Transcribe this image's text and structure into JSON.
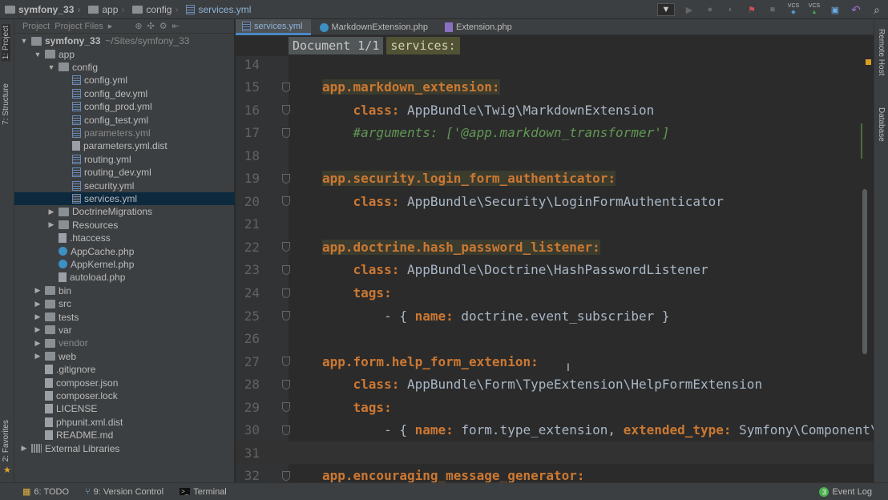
{
  "breadcrumbs": [
    "symfony_33",
    "app",
    "config",
    "services.yml"
  ],
  "toolbar": {
    "vcs1": "VCS",
    "vcs2": "VCS"
  },
  "left_strip": {
    "project": "1: Project",
    "structure": "7: Structure",
    "favorites": "2: Favorites"
  },
  "right_strip": {
    "remote": "Remote Host",
    "database": "Database"
  },
  "project_panel": {
    "tabs": [
      "Project",
      "Project Files"
    ],
    "tree": [
      {
        "label": "symfony_33",
        "path": "~/Sites/symfony_33",
        "depth": 0,
        "arrow": "down",
        "icon": "folder",
        "bold": true
      },
      {
        "label": "app",
        "depth": 1,
        "arrow": "down",
        "icon": "folder"
      },
      {
        "label": "config",
        "depth": 2,
        "arrow": "down",
        "icon": "folder"
      },
      {
        "label": "config.yml",
        "depth": 3,
        "icon": "yml"
      },
      {
        "label": "config_dev.yml",
        "depth": 3,
        "icon": "yml"
      },
      {
        "label": "config_prod.yml",
        "depth": 3,
        "icon": "yml"
      },
      {
        "label": "config_test.yml",
        "depth": 3,
        "icon": "yml"
      },
      {
        "label": "parameters.yml",
        "depth": 3,
        "icon": "yml",
        "dim": true
      },
      {
        "label": "parameters.yml.dist",
        "depth": 3,
        "icon": "file"
      },
      {
        "label": "routing.yml",
        "depth": 3,
        "icon": "yml"
      },
      {
        "label": "routing_dev.yml",
        "depth": 3,
        "icon": "yml"
      },
      {
        "label": "security.yml",
        "depth": 3,
        "icon": "yml"
      },
      {
        "label": "services.yml",
        "depth": 3,
        "icon": "yml",
        "selected": true
      },
      {
        "label": "DoctrineMigrations",
        "depth": 2,
        "arrow": "right",
        "icon": "folder"
      },
      {
        "label": "Resources",
        "depth": 2,
        "arrow": "right",
        "icon": "folder"
      },
      {
        "label": ".htaccess",
        "depth": 2,
        "icon": "file"
      },
      {
        "label": "AppCache.php",
        "depth": 2,
        "icon": "php"
      },
      {
        "label": "AppKernel.php",
        "depth": 2,
        "icon": "php"
      },
      {
        "label": "autoload.php",
        "depth": 2,
        "icon": "file"
      },
      {
        "label": "bin",
        "depth": 1,
        "arrow": "right",
        "icon": "folder"
      },
      {
        "label": "src",
        "depth": 1,
        "arrow": "right",
        "icon": "folder"
      },
      {
        "label": "tests",
        "depth": 1,
        "arrow": "right",
        "icon": "folder"
      },
      {
        "label": "var",
        "depth": 1,
        "arrow": "right",
        "icon": "folder"
      },
      {
        "label": "vendor",
        "depth": 1,
        "arrow": "right",
        "icon": "folder",
        "dim": true
      },
      {
        "label": "web",
        "depth": 1,
        "arrow": "right",
        "icon": "folder"
      },
      {
        "label": ".gitignore",
        "depth": 1,
        "icon": "file"
      },
      {
        "label": "composer.json",
        "depth": 1,
        "icon": "file"
      },
      {
        "label": "composer.lock",
        "depth": 1,
        "icon": "file"
      },
      {
        "label": "LICENSE",
        "depth": 1,
        "icon": "file"
      },
      {
        "label": "phpunit.xml.dist",
        "depth": 1,
        "icon": "file"
      },
      {
        "label": "README.md",
        "depth": 1,
        "icon": "file"
      },
      {
        "label": "External Libraries",
        "depth": 0,
        "arrow": "right",
        "icon": "lib"
      }
    ]
  },
  "editor_tabs": [
    {
      "label": "services.yml",
      "active": true
    },
    {
      "label": "MarkdownExtension.php"
    },
    {
      "label": "Extension.php"
    }
  ],
  "editor_breadcrumb": [
    "Document 1/1",
    "services:"
  ],
  "code": [
    {
      "n": "14",
      "s": []
    },
    {
      "n": "15",
      "s": [
        [
          "kh",
          "app.markdown_extension:"
        ]
      ]
    },
    {
      "n": "16",
      "s": [
        [
          "v",
          "    "
        ],
        [
          "k",
          "class:"
        ],
        [
          "v",
          " AppBundle\\Twig\\MarkdownExtension"
        ]
      ]
    },
    {
      "n": "17",
      "s": [
        [
          "c",
          "    #arguments: ['@app.markdown_transformer']"
        ]
      ]
    },
    {
      "n": "18",
      "s": []
    },
    {
      "n": "19",
      "s": [
        [
          "kh",
          "app.security.login_form_authenticator:"
        ]
      ]
    },
    {
      "n": "20",
      "s": [
        [
          "v",
          "    "
        ],
        [
          "k",
          "class:"
        ],
        [
          "v",
          " AppBundle\\Security\\LoginFormAuthenticator"
        ]
      ]
    },
    {
      "n": "21",
      "s": []
    },
    {
      "n": "22",
      "s": [
        [
          "kh",
          "app.doctrine.hash_password_listener:"
        ]
      ]
    },
    {
      "n": "23",
      "s": [
        [
          "v",
          "    "
        ],
        [
          "k",
          "class:"
        ],
        [
          "v",
          " AppBundle\\Doctrine\\HashPasswordListener"
        ]
      ]
    },
    {
      "n": "24",
      "s": [
        [
          "v",
          "    "
        ],
        [
          "k",
          "tags:"
        ]
      ]
    },
    {
      "n": "25",
      "s": [
        [
          "v",
          "        - { "
        ],
        [
          "k",
          "name:"
        ],
        [
          "v",
          " doctrine.event_subscriber }"
        ]
      ]
    },
    {
      "n": "26",
      "s": []
    },
    {
      "n": "27",
      "s": [
        [
          "k",
          "app.form.help_form_extenion:"
        ]
      ]
    },
    {
      "n": "28",
      "s": [
        [
          "v",
          "    "
        ],
        [
          "k",
          "class:"
        ],
        [
          "v",
          " AppBundle\\Form\\TypeExtension\\HelpFormExtension"
        ]
      ]
    },
    {
      "n": "29",
      "s": [
        [
          "v",
          "    "
        ],
        [
          "k",
          "tags:"
        ]
      ]
    },
    {
      "n": "30",
      "s": [
        [
          "v",
          "        - { "
        ],
        [
          "k",
          "name:"
        ],
        [
          "v",
          " form.type_extension, "
        ],
        [
          "k",
          "extended_type:"
        ],
        [
          "v",
          " Symfony\\Component\\"
        ]
      ]
    },
    {
      "n": "31",
      "s": [],
      "current": true
    },
    {
      "n": "32",
      "s": [
        [
          "k",
          "app.encouraging_message_generator:"
        ]
      ]
    }
  ],
  "bottom_bar": {
    "todo": "6: TODO",
    "vcs": "9: Version Control",
    "terminal": "Terminal",
    "event_log": "Event Log",
    "event_count": "3"
  }
}
